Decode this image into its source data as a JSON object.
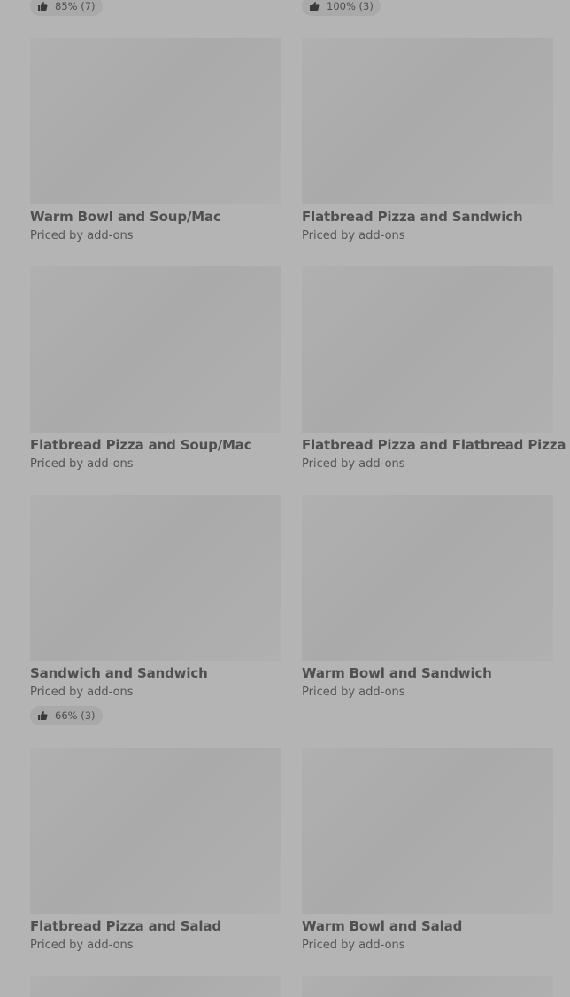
{
  "top_ratings": [
    {
      "label": "85% (7)",
      "icon": "thumbs-up-icon"
    },
    {
      "label": "100% (3)",
      "icon": "thumbs-up-icon"
    }
  ],
  "items": [
    {
      "title": "Warm Bowl and Soup/Mac",
      "price": "Priced by add-ons",
      "rating": null
    },
    {
      "title": "Flatbread Pizza and Sandwich",
      "price": "Priced by add-ons",
      "rating": null
    },
    {
      "title": "Flatbread Pizza and Soup/Mac",
      "price": "Priced by add-ons",
      "rating": null
    },
    {
      "title": "Flatbread Pizza and Flatbread Pizza",
      "price": "Priced by add-ons",
      "rating": null
    },
    {
      "title": "Sandwich and Sandwich",
      "price": "Priced by add-ons",
      "rating": "66% (3)"
    },
    {
      "title": "Warm Bowl and Sandwich",
      "price": "Priced by add-ons",
      "rating": null
    },
    {
      "title": "Flatbread Pizza and Salad",
      "price": "Priced by add-ons",
      "rating": null
    },
    {
      "title": "Warm Bowl and Salad",
      "price": "Priced by add-ons",
      "rating": null
    }
  ],
  "colors": {
    "background": "#b4b4b4",
    "image_placeholder": "#adadad",
    "pill": "#a9a9a9",
    "text": "#505050"
  }
}
